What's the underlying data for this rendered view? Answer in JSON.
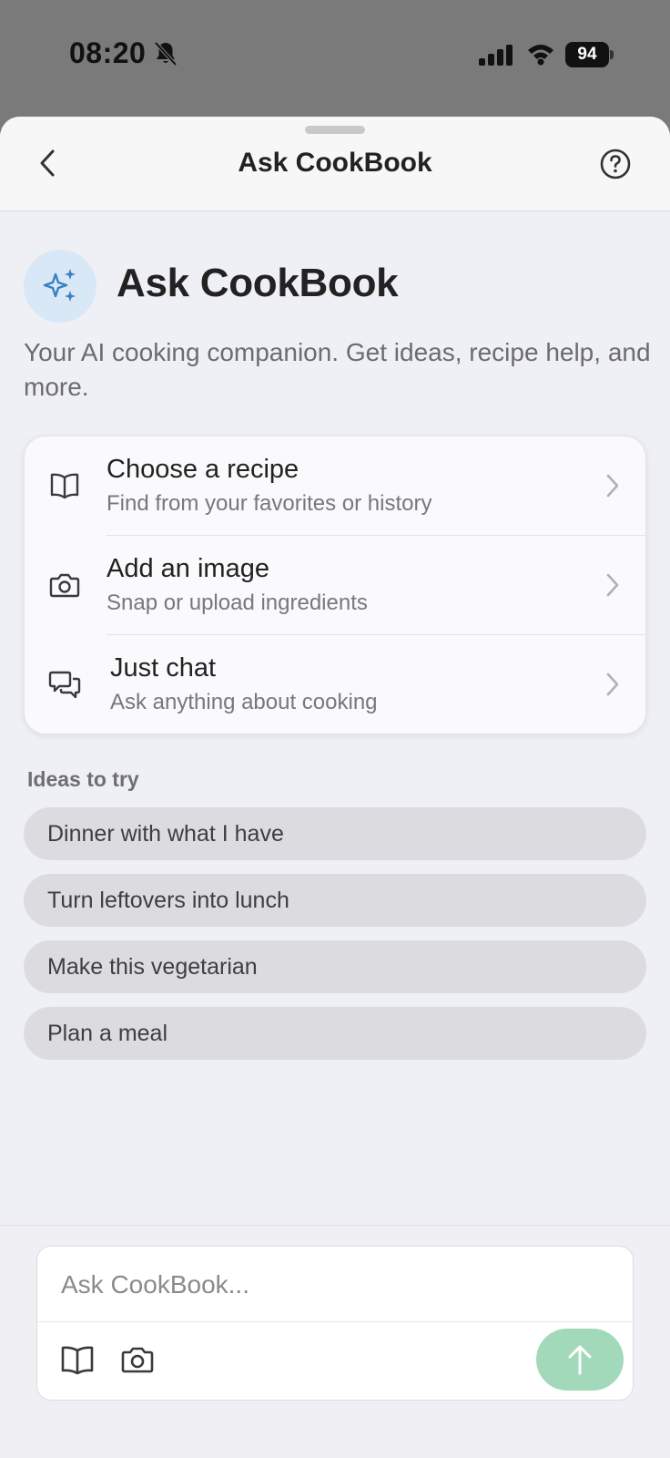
{
  "status_bar": {
    "time": "08:20",
    "battery": "94",
    "icons": [
      "bell-slash-icon",
      "signal-icon",
      "wifi-icon",
      "battery-icon"
    ]
  },
  "nav": {
    "title": "Ask CookBook",
    "back_icon": "chevron-left-icon",
    "help_icon": "question-circle-icon"
  },
  "hero": {
    "icon": "sparkles-icon",
    "title": "Ask CookBook",
    "subtitle": "Your AI cooking companion. Get ideas, recipe help, and more."
  },
  "options": [
    {
      "icon": "book-icon",
      "label": "Choose a recipe",
      "desc": "Find from your favorites or history"
    },
    {
      "icon": "camera-icon",
      "label": "Add an image",
      "desc": "Snap or upload ingredients"
    },
    {
      "icon": "chat-bubbles-icon",
      "label": "Just chat",
      "desc": "Ask anything about cooking"
    }
  ],
  "ideas": {
    "title": "Ideas to try",
    "items": [
      "Dinner with what I have",
      "Turn leftovers into lunch",
      "Make this vegetarian",
      "Plan a meal"
    ]
  },
  "composer": {
    "placeholder": "Ask CookBook...",
    "buttons": [
      "book-icon",
      "camera-icon",
      "arrow-up-icon"
    ]
  },
  "colors": {
    "accent_blue": "#3a7fc4",
    "send_green": "#a3d9bb",
    "chip_bg": "#dcdce0"
  }
}
